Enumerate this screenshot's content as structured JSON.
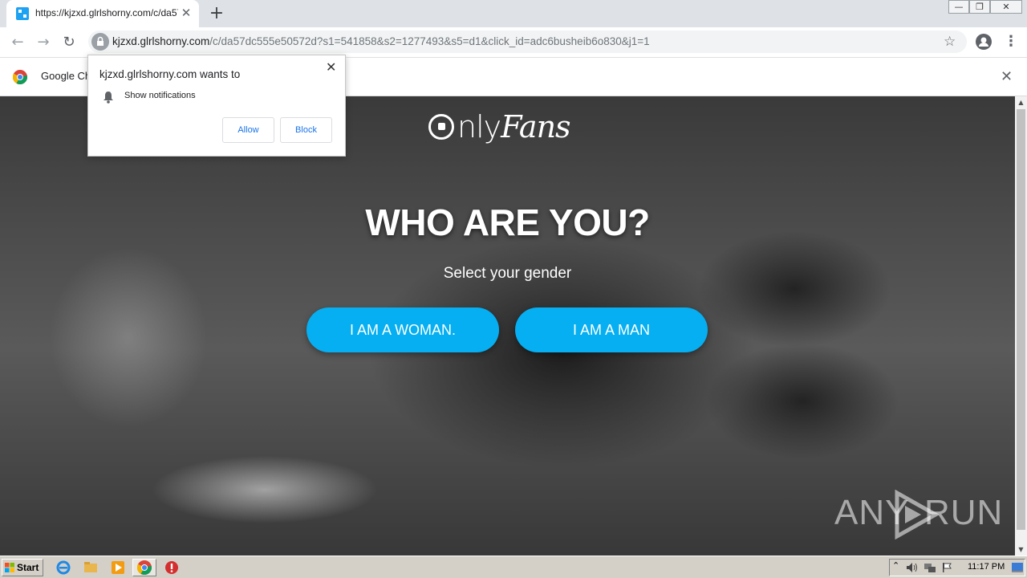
{
  "browser": {
    "tab_title": "https://kjzxd.glrlshorny.com/c/da57",
    "new_tab_symbol": "+",
    "window_controls": [
      "—",
      "❐",
      "✕"
    ],
    "address_host": "kjzxd.glrlshorny.com",
    "address_path": "/c/da57dc555e50572d?s1=541858&s2=1277493&s5=d1&click_id=adc6busheib6o830&j1=1"
  },
  "infobar": {
    "text": "Google Ch",
    "close_symbol": "✕"
  },
  "notification_prompt": {
    "title": "kjzxd.glrlshorny.com wants to",
    "permission": "Show notifications",
    "allow_label": "Allow",
    "block_label": "Block",
    "close_symbol": "✕"
  },
  "page": {
    "logo_only": "nly",
    "logo_fans": "Fans",
    "headline": "WHO ARE YOU?",
    "subheadline": "Select your gender",
    "woman_button": "I AM A WOMAN.",
    "man_button": "I AM A MAN",
    "accent_color": "#05aff2"
  },
  "watermark": {
    "left": "ANY",
    "right": "RUN"
  },
  "taskbar": {
    "start_label": "Start",
    "clock": "11:17 PM"
  }
}
